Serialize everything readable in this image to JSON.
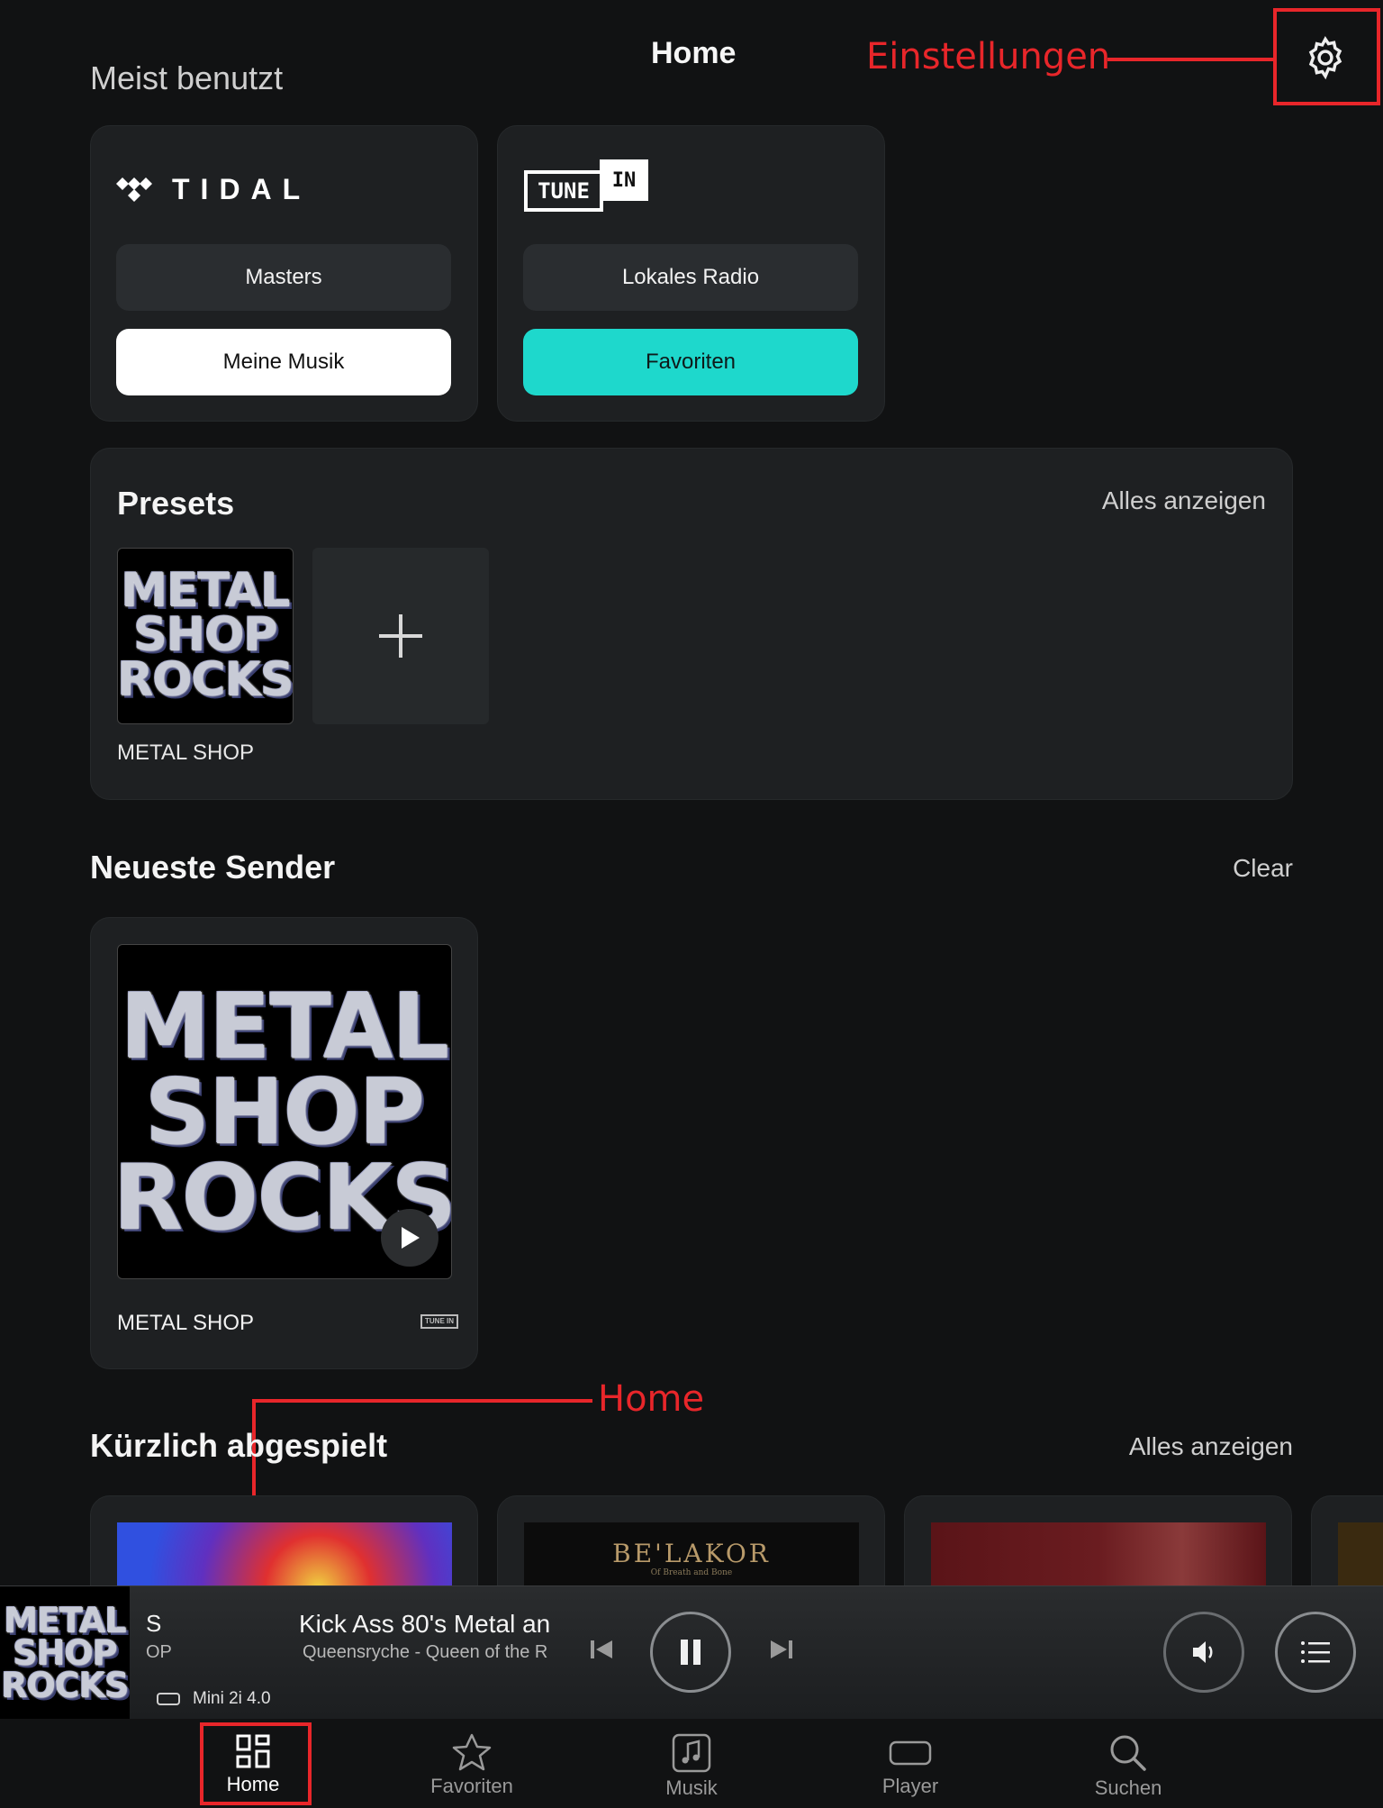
{
  "header": {
    "title": "Home",
    "settings_annotation": "Einstellungen"
  },
  "most_used": {
    "title": "Meist benutzt",
    "tidal": {
      "logo": "TIDAL",
      "btn1": "Masters",
      "btn2": "Meine Musik"
    },
    "tunein": {
      "logo_tune": "TUNE",
      "logo_in": "IN",
      "btn1": "Lokales Radio",
      "btn2": "Favoriten"
    }
  },
  "presets": {
    "title": "Presets",
    "show_all": "Alles anzeigen",
    "items": [
      {
        "label": "METAL SHOP"
      }
    ]
  },
  "recent_stations": {
    "title": "Neueste Sender",
    "clear": "Clear",
    "items": [
      {
        "label": "METAL SHOP"
      }
    ]
  },
  "recently_played": {
    "title": "Kürzlich abgespielt",
    "show_all": "Alles anzeigen",
    "belakor_title": "BE'LAKOR",
    "belakor_subtitle": "Of Breath and Bone"
  },
  "artwork_text": {
    "line1": "METAL",
    "line2": "SHOP",
    "line3": "ROCKS"
  },
  "tunein_badge": "TUNE IN",
  "home_annotation": "Home",
  "player": {
    "station_fragment": "S",
    "station_fragment2": "OP",
    "track_title": "Kick Ass 80's Metal an",
    "track_subtitle": "Queensryche - Queen of the R",
    "device": "Mini 2i 4.0"
  },
  "bottom_nav": [
    {
      "label": "Home",
      "icon": "grid-icon",
      "active": true
    },
    {
      "label": "Favoriten",
      "icon": "star-icon"
    },
    {
      "label": "Musik",
      "icon": "music-note-icon"
    },
    {
      "label": "Player",
      "icon": "speaker-icon"
    },
    {
      "label": "Suchen",
      "icon": "search-icon"
    }
  ],
  "colors": {
    "accent": "#1ed8cc",
    "annotation": "#e8262a",
    "background": "#111213",
    "card": "#1e2022"
  }
}
